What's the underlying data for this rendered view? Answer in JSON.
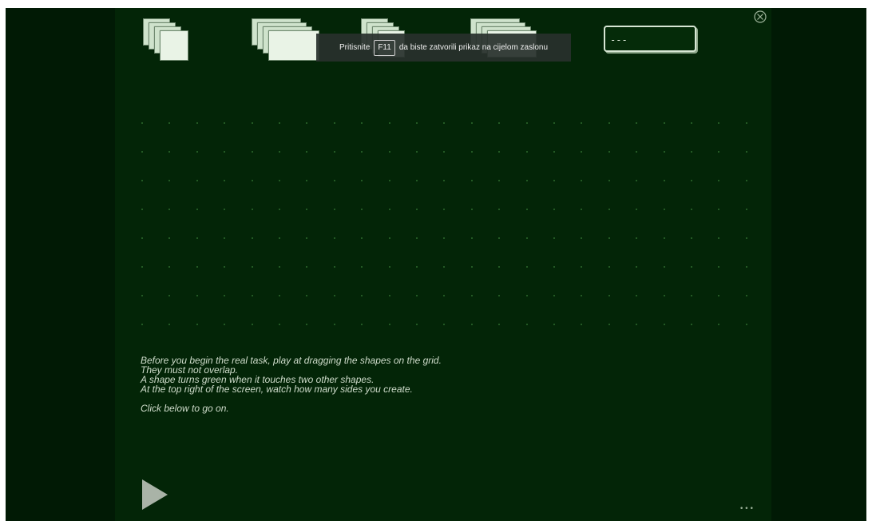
{
  "header": {
    "counter_value": "---",
    "close_icon": "close-circle-icon"
  },
  "fullscreen_notice": {
    "before": "Pritisnite",
    "key": "F11",
    "after": "da biste zatvorili prikaz na cijelom zaslonu"
  },
  "instructions": {
    "lines": [
      "Before you begin the real task, play at dragging the shapes on the grid.",
      "They must not overlap.",
      "A shape turns green when it touches two other shapes.",
      "At the top right of the screen, watch how many sides you create."
    ],
    "continue_text": "Click below to go on."
  },
  "footer": {
    "play_icon": "play-triangle-icon",
    "dots": "•••"
  },
  "colors": {
    "outer_background": "#011a05",
    "stage_background": "#032507",
    "grid_dot": "#2f6b2f",
    "text": "#cfdccb"
  }
}
